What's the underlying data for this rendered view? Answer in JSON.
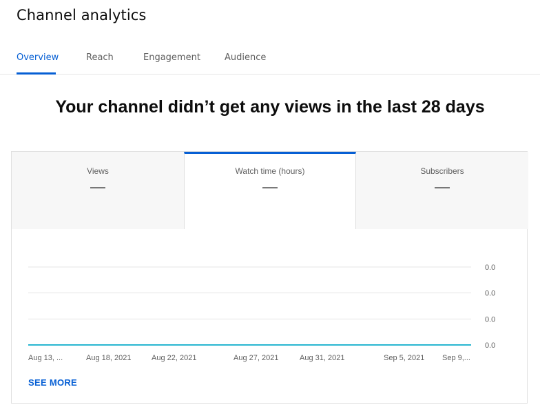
{
  "page": {
    "title": "Channel analytics"
  },
  "tabs": [
    {
      "label": "Overview",
      "active": true
    },
    {
      "label": "Reach",
      "active": false
    },
    {
      "label": "Engagement",
      "active": false
    },
    {
      "label": "Audience",
      "active": false
    }
  ],
  "headline": "Your channel didn’t get any views in the last 28 days",
  "metrics": [
    {
      "label": "Views",
      "value": "—",
      "selected": false
    },
    {
      "label": "Watch time (hours)",
      "value": "—",
      "selected": true
    },
    {
      "label": "Subscribers",
      "value": "—",
      "selected": false
    }
  ],
  "colors": {
    "accent": "#065fd4",
    "series_line": "#29b6d1",
    "gridline": "#e5e5e5"
  },
  "chart_data": {
    "type": "line",
    "x_tick_labels": [
      "Aug 13, ...",
      "Aug 18, 2021",
      "Aug 22, 2021",
      "Aug 27, 2021",
      "Aug 31, 2021",
      "Sep 5, 2021",
      "Sep 9,..."
    ],
    "y_tick_labels": [
      "0.0",
      "0.0",
      "0.0",
      "0.0"
    ],
    "y_ticks": [
      0,
      0,
      0,
      0
    ],
    "series": [
      {
        "x": [
          "Aug 13, 2021",
          "Sep 9, 2021"
        ],
        "values": [
          0,
          0
        ]
      }
    ],
    "grid": true,
    "y_axis_side": "right"
  },
  "footer": {
    "see_more_label": "SEE MORE"
  }
}
